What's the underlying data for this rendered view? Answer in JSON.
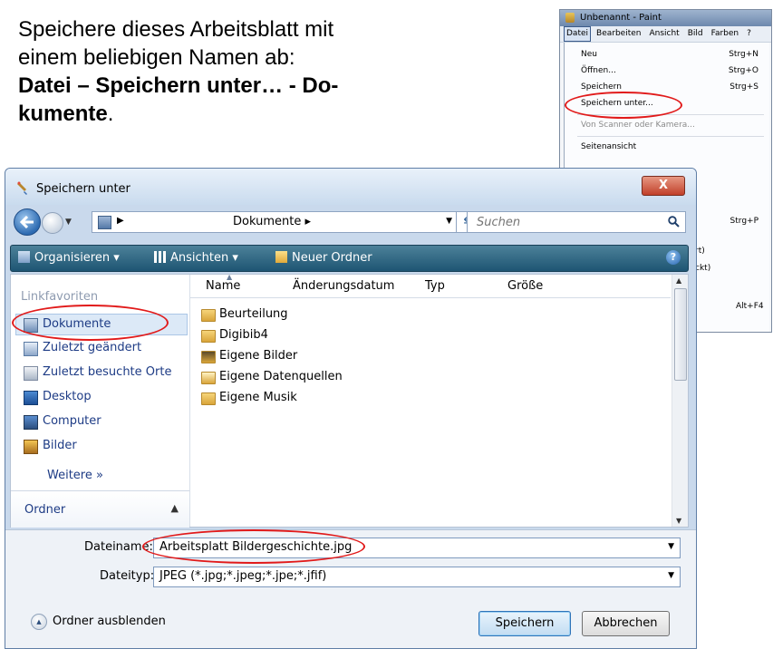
{
  "instruction": {
    "line1": "Speichere dieses Arbeitsblatt mit",
    "line2": "einem beliebigen Namen ab:",
    "line3_bold": "Datei – Speichern unter… - Do-",
    "line4_bold": "kumente",
    "line4_tail": "."
  },
  "paint": {
    "title": "Unbenannt - Paint",
    "menu": [
      "Datei",
      "Bearbeiten",
      "Ansicht",
      "Bild",
      "Farben",
      "?"
    ],
    "items": [
      {
        "label": "Neu",
        "shortcut": "Strg+N"
      },
      {
        "label": "Öffnen...",
        "shortcut": "Strg+O"
      },
      {
        "label": "Speichern",
        "shortcut": "Strg+S"
      },
      {
        "label": "Speichern unter...",
        "shortcut": ""
      },
      {
        "label": "Von Scanner oder Kamera...",
        "shortcut": ""
      },
      {
        "label": "Seitenansicht",
        "shortcut": ""
      }
    ],
    "hidden_shortcut_print": "Strg+P",
    "partial_1": "rt)",
    "partial_2": "ckt)",
    "exit_shortcut": "Alt+F4"
  },
  "dialog": {
    "title": "Speichern unter",
    "close_label": "X",
    "breadcrumb": "Dokumente",
    "search_placeholder": "Suchen",
    "toolbar": {
      "organize": "Organisieren",
      "views": "Ansichten",
      "new_folder": "Neuer Ordner",
      "help": "?"
    },
    "favorites_heading": "Linkfavoriten",
    "favorites": [
      {
        "label": "Dokumente",
        "icon": "documents-icon"
      },
      {
        "label": "Zuletzt geändert",
        "icon": "recent-changed-icon"
      },
      {
        "label": "Zuletzt besuchte Orte",
        "icon": "recent-places-icon"
      },
      {
        "label": "Desktop",
        "icon": "desktop-icon"
      },
      {
        "label": "Computer",
        "icon": "computer-icon"
      },
      {
        "label": "Bilder",
        "icon": "pictures-icon"
      }
    ],
    "more_label": "Weitere »",
    "folder_section": "Ordner",
    "columns": [
      "Name",
      "Änderungsdatum",
      "Typ",
      "Größe"
    ],
    "files": [
      "Beurteilung",
      "Digibib4",
      "Eigene Bilder",
      "Eigene Datenquellen",
      "Eigene Musik"
    ],
    "filename_label": "Dateiname:",
    "filename_value": "Arbeitsplatt Bildergeschichte.jpg",
    "filetype_label": "Dateityp:",
    "filetype_value": "JPEG (*.jpg;*.jpeg;*.jpe;*.jfif)",
    "hide_folders": "Ordner ausblenden",
    "save_button": "Speichern",
    "cancel_button": "Abbrechen"
  },
  "colors": {
    "highlight_red": "#e11a1a",
    "toolbar_teal": "#1e5573",
    "link_blue": "#1d3b85"
  }
}
